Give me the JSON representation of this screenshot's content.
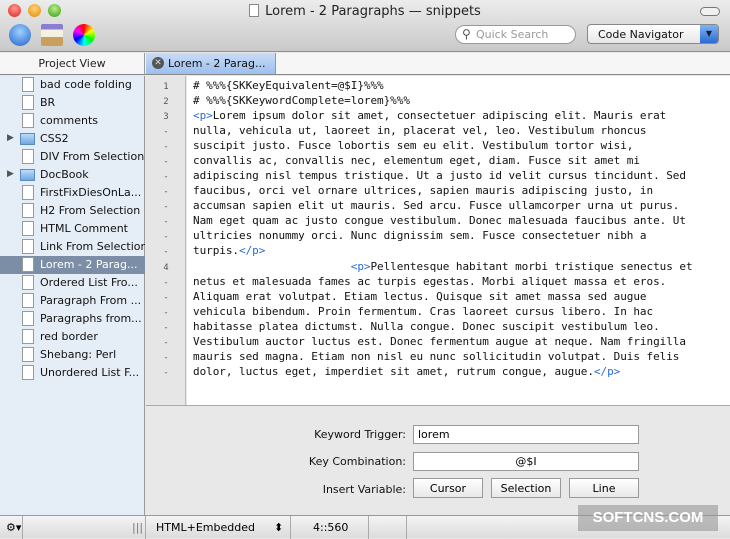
{
  "window": {
    "title": "Lorem - 2 Paragraphs — snippets"
  },
  "toolbar": {
    "search_placeholder": "Quick Search",
    "navigator": "Code Navigator"
  },
  "tabs": {
    "project_view": "Project View",
    "active_tab": "Lorem - 2 Parag..."
  },
  "sidebar": {
    "items": [
      {
        "label": "bad code folding",
        "type": "file"
      },
      {
        "label": "BR",
        "type": "file"
      },
      {
        "label": "comments",
        "type": "file"
      },
      {
        "label": "CSS2",
        "type": "folder"
      },
      {
        "label": "DIV From Selection",
        "type": "file"
      },
      {
        "label": "DocBook",
        "type": "folder"
      },
      {
        "label": "FirstFixDiesOnLa...",
        "type": "file"
      },
      {
        "label": "H2 From Selection",
        "type": "file"
      },
      {
        "label": "HTML Comment",
        "type": "file"
      },
      {
        "label": "Link From Selection",
        "type": "file"
      },
      {
        "label": "Lorem - 2 Parag...",
        "type": "file",
        "selected": true
      },
      {
        "label": "Ordered List Fro...",
        "type": "file"
      },
      {
        "label": "Paragraph From ...",
        "type": "file"
      },
      {
        "label": "Paragraphs from...",
        "type": "file"
      },
      {
        "label": "red border",
        "type": "file"
      },
      {
        "label": "Shebang: Perl",
        "type": "file"
      },
      {
        "label": "Unordered List F...",
        "type": "file"
      }
    ]
  },
  "editor": {
    "lines": [
      {
        "n": "1",
        "pre": "",
        "text": "# %%%{SKKeyEquivalent=@$I}%%%",
        "post": ""
      },
      {
        "n": "2",
        "pre": "",
        "text": "# %%%{SKKeywordComplete=lorem}%%%",
        "post": ""
      },
      {
        "n": "3",
        "pre": "<p>",
        "text": "Lorem ipsum dolor sit amet, consectetuer adipiscing elit. Mauris erat",
        "post": ""
      },
      {
        "n": "-",
        "pre": "",
        "text": "nulla, vehicula ut, laoreet in, placerat vel, leo. Vestibulum rhoncus",
        "post": ""
      },
      {
        "n": "-",
        "pre": "",
        "text": "suscipit justo. Fusce lobortis sem eu elit. Vestibulum tortor wisi,",
        "post": ""
      },
      {
        "n": "-",
        "pre": "",
        "text": "convallis ac, convallis nec, elementum eget, diam. Fusce sit amet mi",
        "post": ""
      },
      {
        "n": "-",
        "pre": "",
        "text": "adipiscing nisl tempus tristique. Ut a justo id velit cursus tincidunt. Sed",
        "post": ""
      },
      {
        "n": "-",
        "pre": "",
        "text": "faucibus, orci vel ornare ultrices, sapien mauris adipiscing justo, in",
        "post": ""
      },
      {
        "n": "-",
        "pre": "",
        "text": "accumsan sapien elit ut mauris. Sed arcu. Fusce ullamcorper urna ut purus.",
        "post": ""
      },
      {
        "n": "-",
        "pre": "",
        "text": "Nam eget quam ac justo congue vestibulum. Donec malesuada faucibus ante. Ut",
        "post": ""
      },
      {
        "n": "-",
        "pre": "",
        "text": "ultricies nonummy orci. Nunc dignissim sem. Fusce consectetuer nibh a",
        "post": ""
      },
      {
        "n": "-",
        "pre": "",
        "text": "turpis.",
        "post": "</p>"
      },
      {
        "n": "4",
        "pre": "                        <p>",
        "text": "Pellentesque habitant morbi tristique senectus et",
        "post": ""
      },
      {
        "n": "-",
        "pre": "",
        "text": "netus et malesuada fames ac turpis egestas. Morbi aliquet massa et eros.",
        "post": ""
      },
      {
        "n": "-",
        "pre": "",
        "text": "Aliquam erat volutpat. Etiam lectus. Quisque sit amet massa sed augue",
        "post": ""
      },
      {
        "n": "-",
        "pre": "",
        "text": "vehicula bibendum. Proin fermentum. Cras laoreet cursus libero. In hac",
        "post": ""
      },
      {
        "n": "-",
        "pre": "",
        "text": "habitasse platea dictumst. Nulla congue. Donec suscipit vestibulum leo.",
        "post": ""
      },
      {
        "n": "-",
        "pre": "",
        "text": "Vestibulum auctor luctus est. Donec fermentum augue at neque. Nam fringilla",
        "post": ""
      },
      {
        "n": "-",
        "pre": "",
        "text": "mauris sed magna. Etiam non nisl eu nunc sollicitudin volutpat. Duis felis",
        "post": ""
      },
      {
        "n": "-",
        "pre": "",
        "text": "dolor, luctus eget, imperdiet sit amet, rutrum congue, augue.",
        "post": "</p>"
      }
    ]
  },
  "panel": {
    "keyword_label": "Keyword Trigger:",
    "keyword_value": "lorem",
    "keycombo_label": "Key Combination:",
    "keycombo_value": "@$I",
    "insert_label": "Insert Variable:",
    "cursor": "Cursor",
    "selection": "Selection",
    "line": "Line"
  },
  "status": {
    "gear": "⚙▾",
    "grip": "|||",
    "syntax": "HTML+Embedded",
    "syntax_arrows": "⬍",
    "position": "4::560"
  },
  "watermark": "SOFTCNS.COM",
  "colors": {
    "tag": "#2a6bd6",
    "selection": "#7c8ea6",
    "tab": "#9dbfee"
  }
}
